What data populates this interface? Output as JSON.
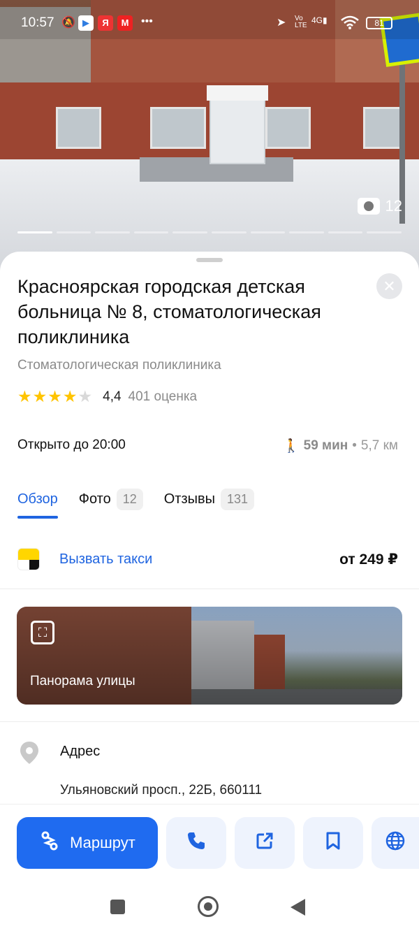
{
  "status_bar": {
    "time": "10:57",
    "battery": "81"
  },
  "photo": {
    "count": "12",
    "total_slides": 10,
    "active_slide": 1
  },
  "place": {
    "title": "Красноярская городская детская больница № 8, стоматологическая поликлиника",
    "category": "Стоматологическая поликлиника",
    "rating": "4,4",
    "rating_stars": 4.4,
    "rating_count": "401 оценка",
    "hours": "Открыто до 20:00",
    "walk_time": "59 мин",
    "distance": "5,7 км",
    "distance_sep": "•"
  },
  "tabs": [
    {
      "label": "Обзор",
      "badge": ""
    },
    {
      "label": "Фото",
      "badge": "12"
    },
    {
      "label": "Отзывы",
      "badge": "131"
    }
  ],
  "taxi": {
    "label": "Вызвать такси",
    "price": "от 249 ₽"
  },
  "panorama": {
    "label": "Панорама улицы"
  },
  "address": {
    "title": "Адрес",
    "value": "Ульяновский просп., 22Б, 660111"
  },
  "actions": {
    "route_label": "Маршрут"
  },
  "colors": {
    "accent": "#1f64e0",
    "star": "#ffc400",
    "taxi_yellow": "#ffd600"
  }
}
